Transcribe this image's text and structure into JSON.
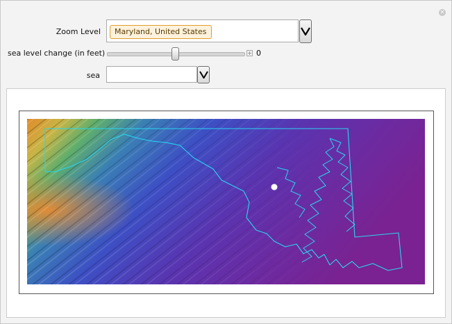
{
  "controls": {
    "zoom_label": "Zoom Level",
    "zoom_value": "Maryland, United States",
    "sea_level_label": "sea level change (in feet)",
    "sea_level_value": "0",
    "sea_level_fraction": 0.5,
    "sea_label": "sea",
    "sea_value": ""
  },
  "icons": {
    "close": "close-icon",
    "dropdown": "chevron-down-icon",
    "increment": "plus-icon"
  },
  "colors": {
    "token_border": "#e39d2a",
    "token_bg": "#fdf2dd",
    "border_outline": "#27d7f0",
    "marker": "#ffffff"
  }
}
